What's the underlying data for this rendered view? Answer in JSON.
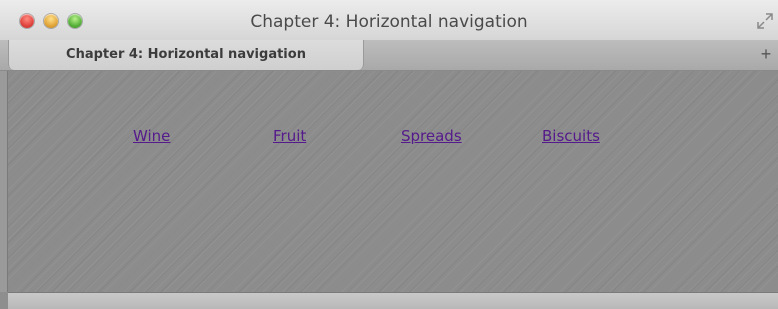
{
  "window": {
    "title": "Chapter 4: Horizontal navigation"
  },
  "tabs": [
    {
      "label": "Chapter 4: Horizontal navigation"
    }
  ],
  "tabbar": {
    "new_tab_label": "+"
  },
  "nav": {
    "items": [
      {
        "label": "Wine"
      },
      {
        "label": "Fruit"
      },
      {
        "label": "Spreads"
      },
      {
        "label": "Biscuits"
      }
    ]
  },
  "colors": {
    "link": "#551a8b",
    "content_bg": "#8c8c8c"
  }
}
